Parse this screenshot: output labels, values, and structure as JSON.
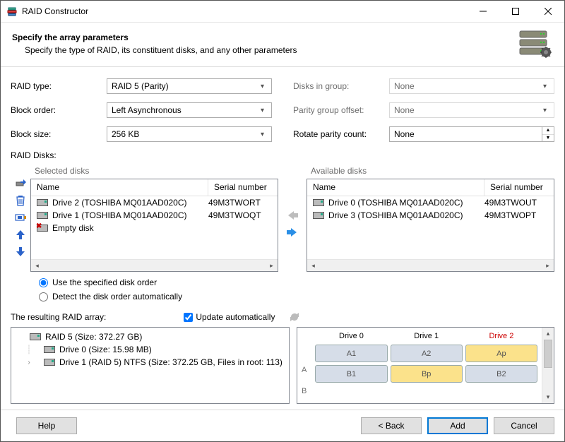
{
  "window": {
    "title": "RAID Constructor"
  },
  "header": {
    "heading": "Specify the array parameters",
    "subheading": "Specify the type of RAID, its constituent disks, and any other parameters"
  },
  "params": {
    "raid_type": {
      "label": "RAID type:",
      "value": "RAID 5 (Parity)"
    },
    "block_order": {
      "label": "Block order:",
      "value": "Left Asynchronous"
    },
    "block_size": {
      "label": "Block size:",
      "value": "256 KB"
    },
    "disks_in_group": {
      "label": "Disks in group:",
      "value": "None"
    },
    "parity_group_offset": {
      "label": "Parity group offset:",
      "value": "None"
    },
    "rotate_parity": {
      "label": "Rotate parity count:",
      "value": "None"
    }
  },
  "raid_disks_label": "RAID Disks:",
  "lists": {
    "selected_title": "Selected disks",
    "available_title": "Available disks",
    "col_name": "Name",
    "col_serial": "Serial number",
    "selected": [
      {
        "name": "Drive 2 (TOSHIBA MQ01AAD020C)",
        "serial": "49M3TWORT",
        "icon": "drive"
      },
      {
        "name": "Drive 1 (TOSHIBA MQ01AAD020C)",
        "serial": "49M3TWOQT",
        "icon": "drive"
      },
      {
        "name": "Empty disk",
        "serial": "",
        "icon": "empty"
      }
    ],
    "available": [
      {
        "name": "Drive 0 (TOSHIBA MQ01AAD020C)",
        "serial": "49M3TWOUT",
        "icon": "drive"
      },
      {
        "name": "Drive 3 (TOSHIBA MQ01AAD020C)",
        "serial": "49M3TWOPT",
        "icon": "drive"
      }
    ]
  },
  "order_options": {
    "specified": "Use the specified disk order",
    "detect": "Detect the disk order automatically"
  },
  "resulting": {
    "label": "The resulting RAID array:",
    "update_label": "Update automatically",
    "tree": {
      "root": "RAID 5 (Size: 372.27 GB)",
      "child0": "Drive 0 (Size: 15.98 MB)",
      "child1": "Drive 1 (RAID 5) NTFS (Size: 372.25 GB, Files in root: 113)"
    }
  },
  "grid": {
    "rows": [
      "A",
      "B"
    ],
    "cols": [
      {
        "label": "Drive 0",
        "highlight": false,
        "cells": [
          "A1",
          "B1"
        ],
        "kinds": [
          "blue",
          "blue"
        ]
      },
      {
        "label": "Drive 1",
        "highlight": false,
        "cells": [
          "A2",
          "Bp"
        ],
        "kinds": [
          "blue",
          "yellow"
        ]
      },
      {
        "label": "Drive 2",
        "highlight": true,
        "cells": [
          "Ap",
          "B2"
        ],
        "kinds": [
          "yellow",
          "blue"
        ]
      }
    ]
  },
  "footer": {
    "help": "Help",
    "back": "< Back",
    "add": "Add",
    "cancel": "Cancel"
  }
}
